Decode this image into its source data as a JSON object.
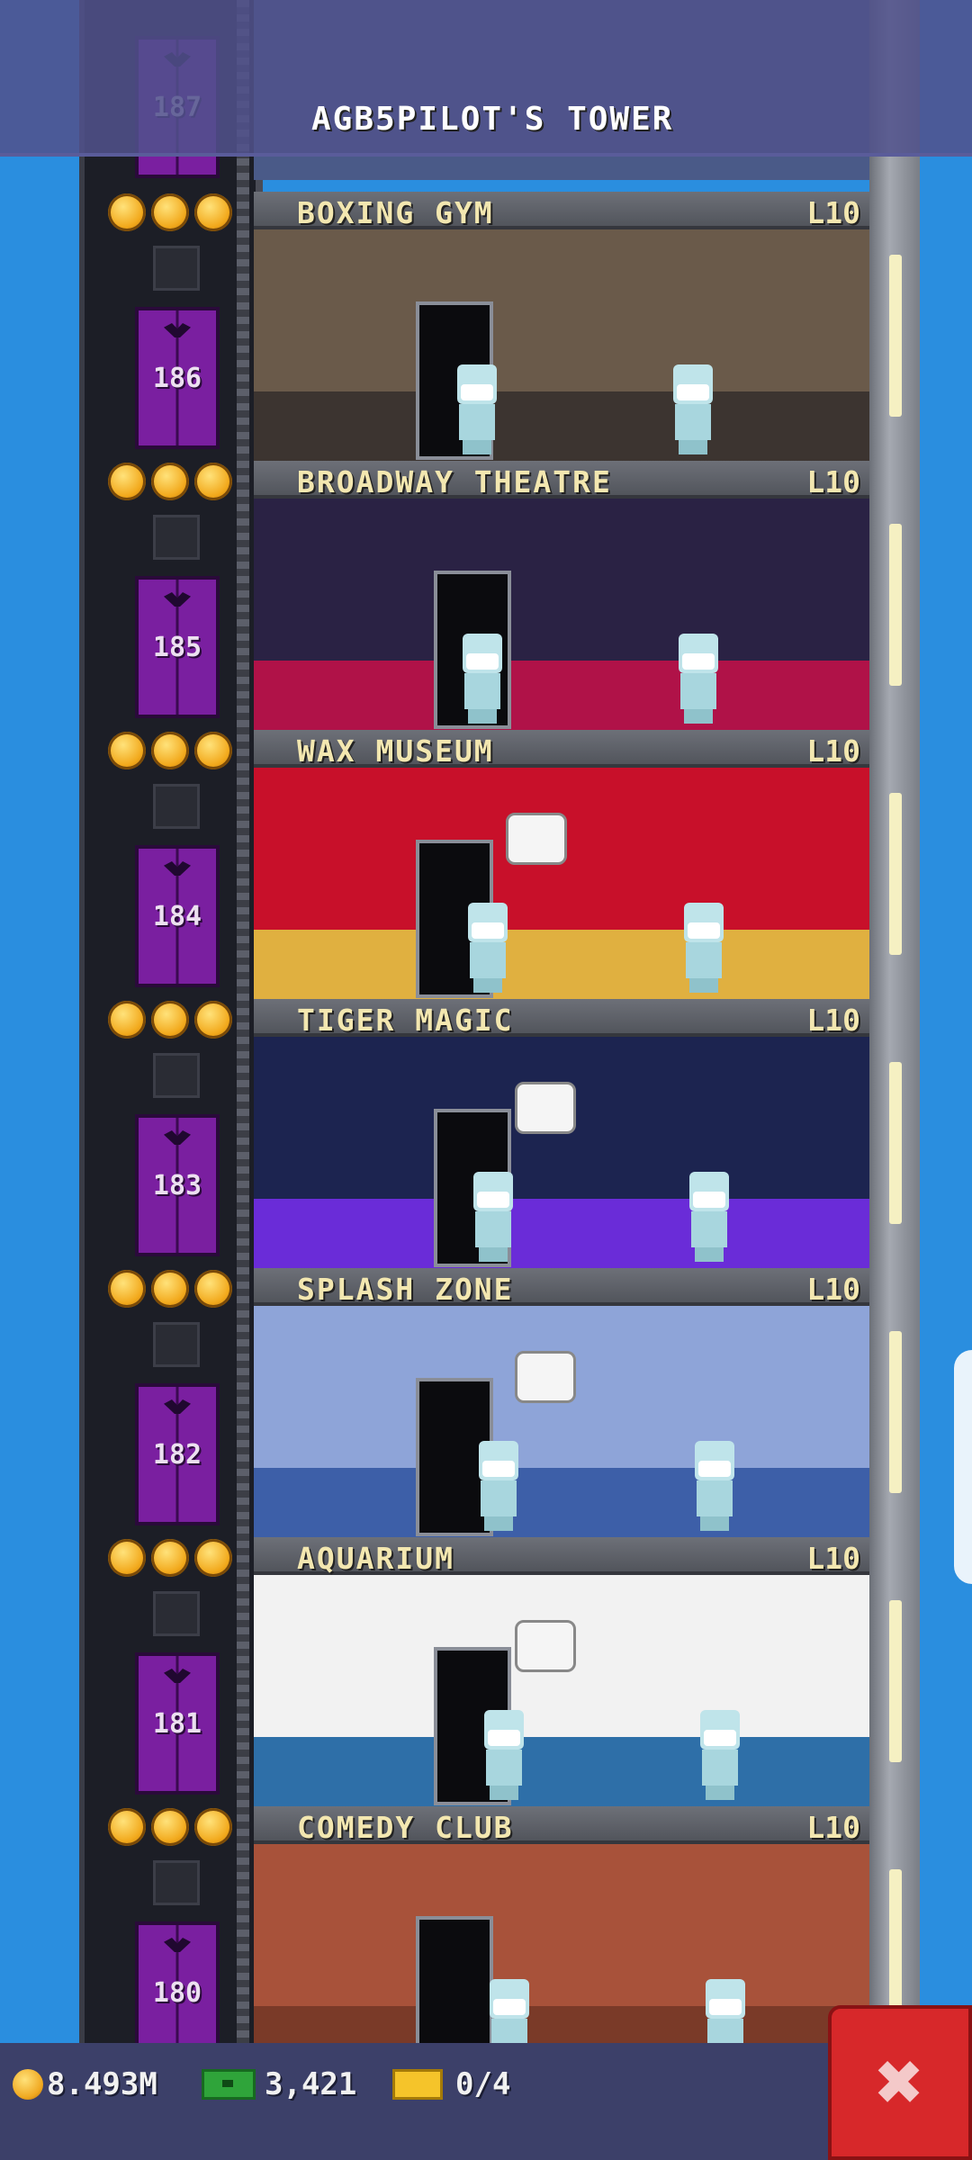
{
  "tower": {
    "title": "AGB5PILOT'S TOWER"
  },
  "top_floor": {
    "number": "187"
  },
  "floors": [
    {
      "name": "BOXING GYM",
      "level": "L10",
      "number": "186",
      "stars": 3,
      "bg": "#6a5a4a",
      "accent": "#3c3430"
    },
    {
      "name": "BROADWAY THEATRE",
      "level": "L10",
      "number": "185",
      "stars": 3,
      "bg": "#2a2244",
      "accent": "#b01248"
    },
    {
      "name": "WAX MUSEUM",
      "level": "L10",
      "number": "184",
      "stars": 3,
      "bg": "#c8102a",
      "accent": "#e0b040"
    },
    {
      "name": "TIGER MAGIC",
      "level": "L10",
      "number": "183",
      "stars": 3,
      "bg": "#1c2450",
      "accent": "#6a2cd8"
    },
    {
      "name": "SPLASH ZONE",
      "level": "L10",
      "number": "182",
      "stars": 3,
      "bg": "#8ea4d8",
      "accent": "#3d5fa8"
    },
    {
      "name": "AQUARIUM",
      "level": "L10",
      "number": "181",
      "stars": 3,
      "bg": "#f2f2f2",
      "accent": "#2e6fa8"
    },
    {
      "name": "COMEDY CLUB",
      "level": "L10",
      "number": "180",
      "stars": 3,
      "bg": "#a8523a",
      "accent": "#7a3a28"
    }
  ],
  "resources": {
    "coins": "8.493M",
    "bux": "3,421",
    "tickets": "0/4"
  },
  "icons": {
    "coin": "coin-icon",
    "bux": "bux-icon",
    "ticket": "golden-ticket-icon",
    "close": "close-icon",
    "star": "star-icon"
  },
  "close_button": {
    "label": "✖"
  }
}
